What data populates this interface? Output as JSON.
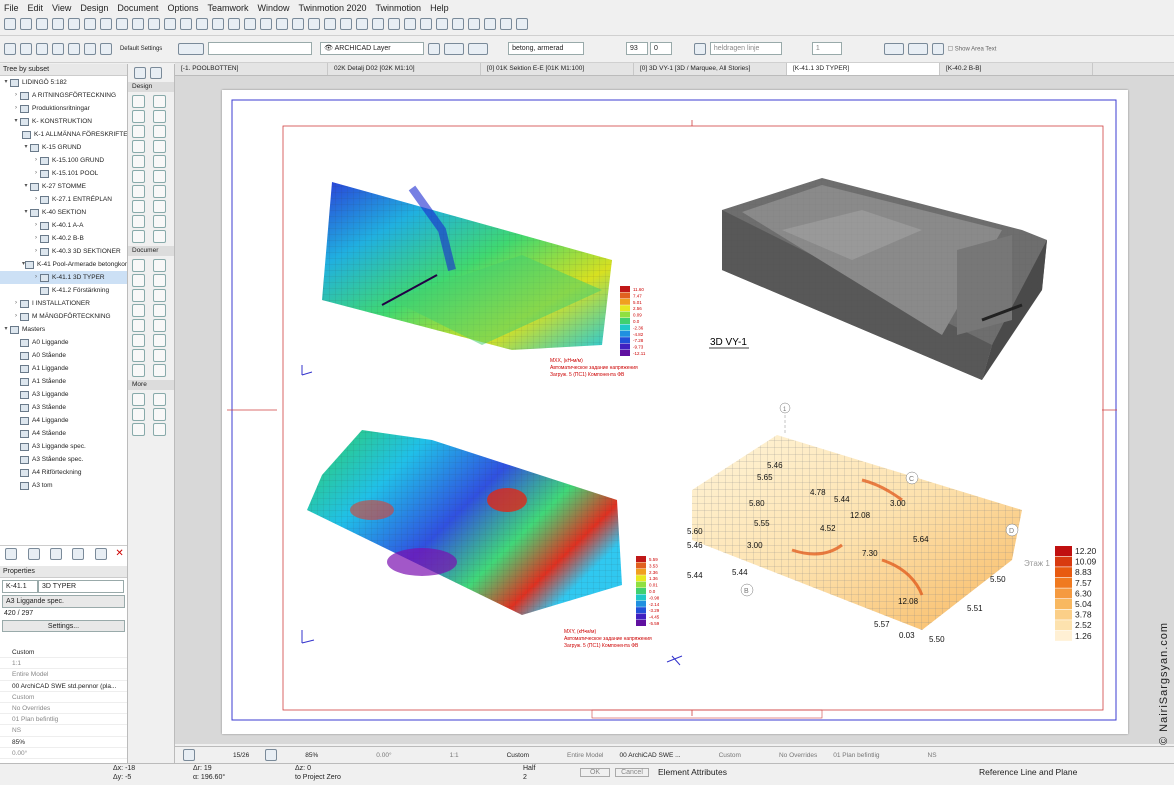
{
  "menu": [
    "File",
    "Edit",
    "View",
    "Design",
    "Document",
    "Options",
    "Teamwork",
    "Window",
    "Twinmotion 2020",
    "Twinmotion",
    "Help"
  ],
  "info_box": {
    "default_settings": "Default Settings",
    "layer": "ARCHICAD Layer",
    "material": "betong, armerad",
    "height_value": "93",
    "offset_value": "0",
    "line_type": "heldragen linje",
    "count": "1",
    "show_area": "Show Area Text"
  },
  "sidebar": {
    "header": "Tree by subset",
    "items": [
      {
        "label": "LIDINGÖ 5:182",
        "level": 0,
        "twist": "▾"
      },
      {
        "label": "A RITNINGSFÖRTECKNING",
        "level": 1,
        "twist": "›"
      },
      {
        "label": "Produktionsritningar",
        "level": 1,
        "twist": "›"
      },
      {
        "label": "K- KONSTRUKTION",
        "level": 1,
        "twist": "▾"
      },
      {
        "label": "K-1 ALLMÄNNA FÖRESKRIFTER",
        "level": 2,
        "twist": ""
      },
      {
        "label": "K-15 GRUND",
        "level": 2,
        "twist": "▾"
      },
      {
        "label": "K-15.100 GRUND",
        "level": 3,
        "twist": "›"
      },
      {
        "label": "K-15.101 POOL",
        "level": 3,
        "twist": "›"
      },
      {
        "label": "K-27 STOMME",
        "level": 2,
        "twist": "▾"
      },
      {
        "label": "K-27.1 ENTRÉPLAN",
        "level": 3,
        "twist": "›"
      },
      {
        "label": "K-40 SEKTION",
        "level": 2,
        "twist": "▾"
      },
      {
        "label": "K-40.1 A-A",
        "level": 3,
        "twist": "›"
      },
      {
        "label": "K-40.2 B-B",
        "level": 3,
        "twist": "›"
      },
      {
        "label": "K-40.3 3D SEKTIONER",
        "level": 3,
        "twist": "›"
      },
      {
        "label": "K-41 Pool-Armerade betongkonstr",
        "level": 2,
        "twist": "▾"
      },
      {
        "label": "K-41.1 3D TYPER",
        "level": 3,
        "twist": "›",
        "selected": true
      },
      {
        "label": "K-41.2 Förstärkning",
        "level": 3,
        "twist": ""
      },
      {
        "label": "I INSTALLATIONER",
        "level": 1,
        "twist": "›"
      },
      {
        "label": "M MÄNGDFÖRTECKNING",
        "level": 1,
        "twist": "›"
      },
      {
        "label": "Masters",
        "level": 0,
        "twist": "▾"
      },
      {
        "label": "A0 Liggande",
        "level": 1,
        "twist": ""
      },
      {
        "label": "A0 Stående",
        "level": 1,
        "twist": ""
      },
      {
        "label": "A1 Liggande",
        "level": 1,
        "twist": ""
      },
      {
        "label": "A1 Stående",
        "level": 1,
        "twist": ""
      },
      {
        "label": "A3 Liggande",
        "level": 1,
        "twist": ""
      },
      {
        "label": "A3 Stående",
        "level": 1,
        "twist": ""
      },
      {
        "label": "A4 Liggande",
        "level": 1,
        "twist": ""
      },
      {
        "label": "A4 Stående",
        "level": 1,
        "twist": ""
      },
      {
        "label": "A3 Liggande spec.",
        "level": 1,
        "twist": ""
      },
      {
        "label": "A3 Stående spec.",
        "level": 1,
        "twist": ""
      },
      {
        "label": "A4 Ritförteckning",
        "level": 1,
        "twist": ""
      },
      {
        "label": "A3 tom",
        "level": 1,
        "twist": ""
      }
    ]
  },
  "properties": {
    "header": "Properties",
    "id": "K-41.1",
    "name": "3D TYPER",
    "master": "A3 Liggande spec.",
    "size": "420 / 297",
    "settings": "Settings..."
  },
  "lower_panel": [
    "Custom",
    "1:1",
    "Entire Model",
    "00 ArchiCAD SWE std.pennor (pla...",
    "Custom",
    "No Overrides",
    "01 Plan befintlig",
    "NS",
    "85%",
    "0.00°"
  ],
  "toolbox": {
    "design": "Design",
    "document": "Documer",
    "more": "More"
  },
  "tabs": [
    "[-1. POOLBOTTEN]",
    "02K Detalj D02 [02K M1:10]",
    "[0] 01K Sektion E-E [01K M1:100]",
    "[0] 3D VY-1 [3D / Marquee, All Stories]",
    "[K-41.1 3D TYPER]",
    "[K-40.2 B-B]"
  ],
  "sheet": {
    "view_title": "3D VY-1",
    "mxx_label": "MXX, (кН•м/м)",
    "mxx_sub1": "Автоматическое задание напряжения",
    "mxx_sub2": "Загруж. 5 (ПС1) Компонента ФВ",
    "mxy_label": "MXY, (кН•м/м)",
    "mxy_sub1": "Автоматическое задание напряжения",
    "mxy_sub2": "Загруж. 5 (ПС1) Компонента ФВ",
    "legend1": [
      "11.60",
      "7.47",
      "5.01",
      "2.56",
      "0.09",
      "0.0",
      "-2.36",
      "-4.82",
      "-7.28",
      "-9.73",
      "-12.11"
    ],
    "legend2": [
      "5.59",
      "3.53",
      "2.36",
      "1.36",
      "0.01",
      "0.0",
      "-0.98",
      "-2.14",
      "-3.29",
      "-4.45",
      "-5.59"
    ],
    "legend3": [
      "12.20",
      "10.09",
      "8.83",
      "7.57",
      "6.30",
      "5.04",
      "3.78",
      "2.52",
      "1.26"
    ],
    "legend3_colors": [
      "#c01010",
      "#d83a10",
      "#e85a10",
      "#f07a20",
      "#f59a40",
      "#f8b860",
      "#fbcf88",
      "#fde2ae",
      "#fff0d4"
    ],
    "etazh": "Этаж 1",
    "axis_c": "C",
    "axis_b": "B",
    "axis_d": "D",
    "axis_1": "1",
    "wire_nums": [
      "5.65",
      "5.46",
      "5.80",
      "5.55",
      "4.78",
      "5.44",
      "3.00",
      "12.08",
      "12.08",
      "7.30",
      "5.64",
      "3.00",
      "5.44",
      "5.50",
      "5.51",
      "5.57",
      "0.03",
      "5.50",
      "5.60",
      "5.46",
      "5.44",
      "4.52"
    ]
  },
  "statusbar": {
    "page": "15/26",
    "zoom": "85%",
    "angle": "0.00°",
    "scale": "1:1",
    "view": "Custom",
    "model": "Entire Model",
    "pen": "00 ArchiCAD SWE ...",
    "custom2": "Custom",
    "overrides": "No Overrides",
    "plan": "01 Plan befintlig",
    "ns": "NS"
  },
  "bottom": {
    "dx": "Δx: -18",
    "dy": "Δy: -5",
    "ar": "Δr: 19",
    "angle": "α: 196.60°",
    "az": "Δz: 0",
    "to_zero": "to Project Zero",
    "half": "Half",
    "half_n": "2",
    "ok": "OK",
    "cancel": "Cancel",
    "element_attributes": "Element Attributes",
    "ref_line": "Reference Line and Plane"
  },
  "watermark": "© NairiSargsyan.com"
}
